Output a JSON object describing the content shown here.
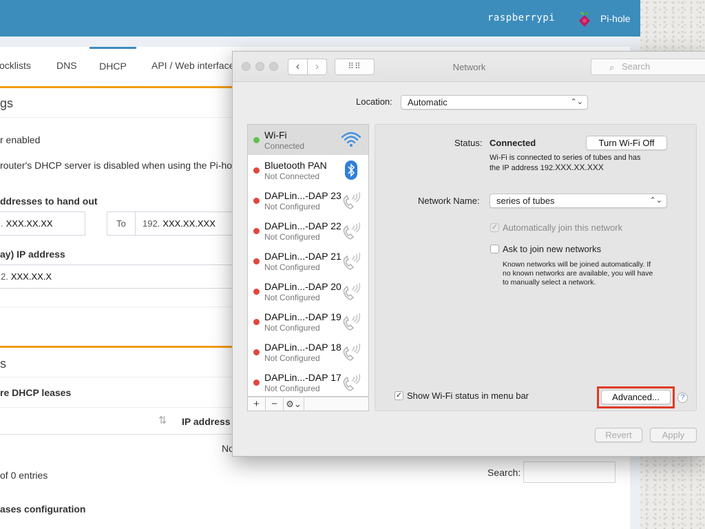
{
  "pihole": {
    "hostname": "raspberrypi",
    "brand": "Pi-hole",
    "tabs": [
      "ocklists",
      "DNS",
      "DHCP",
      "API / Web interface"
    ],
    "active_tab": "DHCP",
    "settings_title": "gs",
    "enabled_label": "r enabled",
    "dhcp_note": "router's DHCP server is disabled when using the Pi-hole",
    "range_label": "ddresses to hand out",
    "range_from": {
      "prefix": ".",
      "value": "XXX.XX.XX"
    },
    "range_to_label": "To",
    "range_to": {
      "prefix": "192.",
      "value": "XXX.XX.XXX"
    },
    "router_label": "ay) IP address",
    "router_ip": {
      "prefix": "2.",
      "value": "XXX.XX.X"
    },
    "leases_section": "s",
    "active_leases_label": "re DHCP leases",
    "ip_col": "IP address",
    "no_data": "No",
    "entries_info": "of 0 entries",
    "search_label": "Search:",
    "static_leases_label": "ases configuration"
  },
  "network": {
    "title": "Network",
    "search_placeholder": "Search",
    "location_label": "Location:",
    "location_value": "Automatic",
    "services": [
      {
        "name": "Wi-Fi",
        "status": "Connected",
        "dot": "#5ec24a",
        "icon": "wifi-icon"
      },
      {
        "name": "Bluetooth PAN",
        "status": "Not Connected",
        "dot": "#e2463e",
        "icon": "bluetooth-icon"
      },
      {
        "name": "DAPLin...-DAP 23",
        "status": "Not Configured",
        "dot": "#e2463e",
        "icon": "phone-icon"
      },
      {
        "name": "DAPLin...-DAP 22",
        "status": "Not Configured",
        "dot": "#e2463e",
        "icon": "phone-icon"
      },
      {
        "name": "DAPLin...-DAP 21",
        "status": "Not Configured",
        "dot": "#e2463e",
        "icon": "phone-icon"
      },
      {
        "name": "DAPLin...-DAP 20",
        "status": "Not Configured",
        "dot": "#e2463e",
        "icon": "phone-icon"
      },
      {
        "name": "DAPLin...-DAP 19",
        "status": "Not Configured",
        "dot": "#e2463e",
        "icon": "phone-icon"
      },
      {
        "name": "DAPLin...-DAP 18",
        "status": "Not Configured",
        "dot": "#e2463e",
        "icon": "phone-icon"
      },
      {
        "name": "DAPLin...-DAP 17",
        "status": "Not Configured",
        "dot": "#e2463e",
        "icon": "phone-icon"
      }
    ],
    "list_footer": {
      "add": "+",
      "remove": "−",
      "gear": "⚙⌄"
    },
    "status_label": "Status:",
    "status_value": "Connected",
    "turn_off_button": "Turn Wi-Fi Off",
    "status_desc_1": "Wi-Fi is connected to series of tubes and has",
    "status_desc_2_prefix": "the IP address 192.",
    "status_desc_2_value": "XXX.XX.XXX",
    "network_name_label": "Network Name:",
    "network_name_value": "series of tubes",
    "auto_join_label": "Automatically join this network",
    "ask_join_label": "Ask to join new networks",
    "ask_desc_1": "Known networks will be joined automatically. If",
    "ask_desc_2": "no known networks are available, you will have",
    "ask_desc_3": "to manually select a network.",
    "show_status_label": "Show Wi-Fi status in menu bar",
    "advanced_button": "Advanced...",
    "help": "?",
    "revert_button": "Revert",
    "apply_button": "Apply",
    "check_mark": "✓"
  },
  "colors": {
    "pihole_blue": "#3c8dbc",
    "orange": "#f39c12",
    "highlight_red": "#e03a26"
  }
}
